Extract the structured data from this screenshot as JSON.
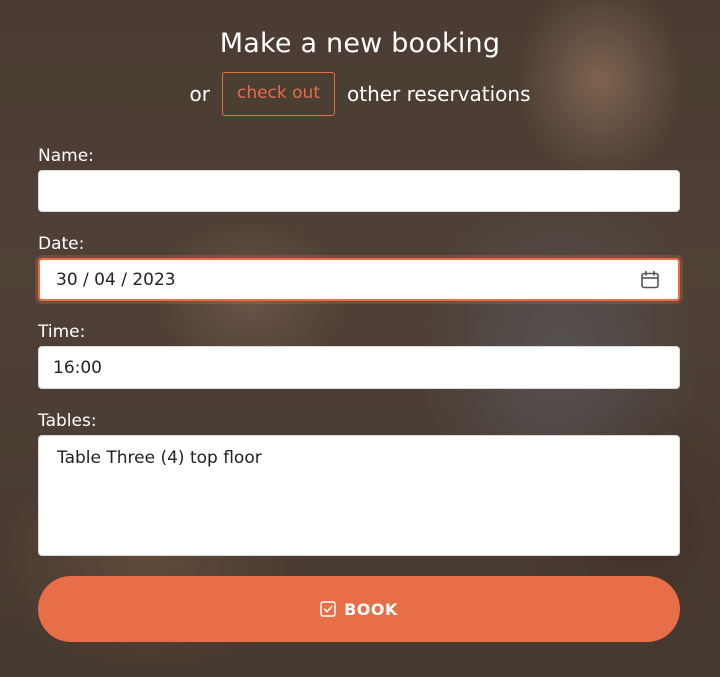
{
  "header": {
    "title": "Make a new booking",
    "prefix": "or",
    "checkout_label": "check out",
    "suffix": "other reservations"
  },
  "form": {
    "name": {
      "label": "Name:",
      "value": ""
    },
    "date": {
      "label": "Date:",
      "value": "30 / 04 / 2023"
    },
    "time": {
      "label": "Time:",
      "value": "16:00"
    },
    "tables": {
      "label": "Tables:",
      "selected": "Table Three (4) top floor"
    }
  },
  "book_button": {
    "label": "BOOK"
  },
  "colors": {
    "accent": "#e86e48",
    "text_light": "#ffffff"
  },
  "icons": {
    "date": "calendar-icon",
    "book": "checkbox-check-icon"
  }
}
